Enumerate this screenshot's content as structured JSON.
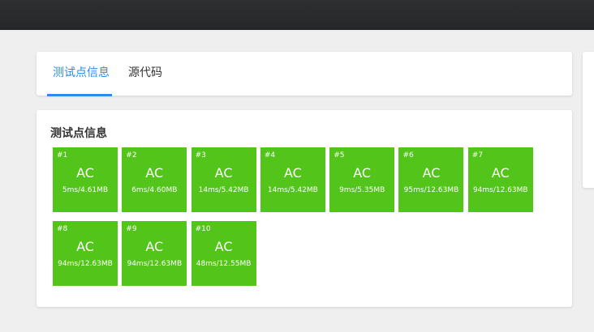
{
  "tabs": [
    {
      "label": "测试点信息",
      "active": true
    },
    {
      "label": "源代码",
      "active": false
    }
  ],
  "section": {
    "title": "测试点信息"
  },
  "colors": {
    "accent": "#2d8cf0",
    "accepted": "#52c41a",
    "topbar": "#2b2c2e"
  },
  "cases": [
    {
      "id": "#1",
      "status": "AC",
      "usage": "5ms/4.61MB"
    },
    {
      "id": "#2",
      "status": "AC",
      "usage": "6ms/4.60MB"
    },
    {
      "id": "#3",
      "status": "AC",
      "usage": "14ms/5.42MB"
    },
    {
      "id": "#4",
      "status": "AC",
      "usage": "14ms/5.42MB"
    },
    {
      "id": "#5",
      "status": "AC",
      "usage": "9ms/5.35MB"
    },
    {
      "id": "#6",
      "status": "AC",
      "usage": "95ms/12.63MB"
    },
    {
      "id": "#7",
      "status": "AC",
      "usage": "94ms/12.63MB"
    },
    {
      "id": "#8",
      "status": "AC",
      "usage": "94ms/12.63MB"
    },
    {
      "id": "#9",
      "status": "AC",
      "usage": "94ms/12.63MB"
    },
    {
      "id": "#10",
      "status": "AC",
      "usage": "48ms/12.55MB"
    }
  ]
}
